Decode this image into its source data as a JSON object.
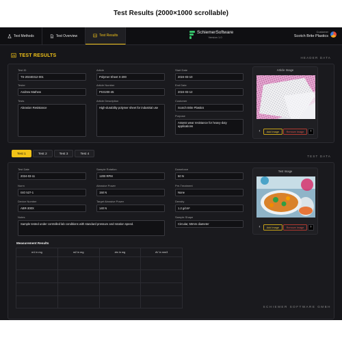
{
  "page_title": "Test Results (2000×1000 scrollable)",
  "nav": {
    "items": [
      {
        "label": "Test Methods"
      },
      {
        "label": "Test Overview"
      },
      {
        "label": "Test Results"
      }
    ]
  },
  "brand": {
    "name": "SchiemerSoftware",
    "version": "Version 1.0"
  },
  "customer": {
    "label": "Customer",
    "name": "Scotch Brite Plastics"
  },
  "header_section": {
    "title": "TEST RESULTS",
    "tag": "HEADER DATA"
  },
  "header": {
    "test_id": {
      "label": "Test ID",
      "value": "TS-20240312-001"
    },
    "tester": {
      "label": "Tester",
      "value": "Andrew Mathew"
    },
    "tests": {
      "label": "Tests",
      "value": "Abrasion Resistance"
    },
    "article": {
      "label": "Article",
      "value": "Polymer Sheet X-200"
    },
    "article_number": {
      "label": "Article Number",
      "value": "PSX200-45"
    },
    "article_description": {
      "label": "Article Description",
      "value": "High-durability polymer sheet for industrial use"
    },
    "start_date": {
      "label": "Start Date",
      "value": "2024-03-10"
    },
    "end_date": {
      "label": "End Date",
      "value": "2024-03-12"
    },
    "customer": {
      "label": "Customer",
      "value": "Scotch Brite Plastics"
    },
    "purpose": {
      "label": "Purpose",
      "value": "Assess wear resistance for heavy-duty applications"
    },
    "image_card": {
      "title": "Article Image",
      "add_label": "Add Image",
      "remove_label": "Remove Image",
      "prev": "‹",
      "next": "›"
    }
  },
  "test_tabs": [
    {
      "label": "Test 1",
      "active": true
    },
    {
      "label": "Test 2"
    },
    {
      "label": "Test 3"
    },
    {
      "label": "Test 4"
    }
  ],
  "test_section": {
    "tag": "TEST DATA"
  },
  "test": {
    "test_date": {
      "label": "Test Date",
      "value": "2024-03-11"
    },
    "norm": {
      "label": "Norm",
      "value": "ISO 527-1"
    },
    "device_number": {
      "label": "Device Number",
      "value": "ABR-300X"
    },
    "sample_rotation": {
      "label": "Sample Rotation",
      "value": "1200 RPM"
    },
    "abrasive_power": {
      "label": "Abrasive Power",
      "value": "150 N"
    },
    "target_abrasive_power": {
      "label": "Target Abrasive Power",
      "value": "140 N"
    },
    "downforce": {
      "label": "Downforce",
      "value": "50 N"
    },
    "pre_treatment": {
      "label": "Pre-Treatment",
      "value": "None"
    },
    "density": {
      "label": "Density",
      "value": "1.2 g/cm³"
    },
    "sample_shape": {
      "label": "Sample Shape",
      "value": "Circular, 50mm diameter"
    },
    "notes": {
      "label": "Notes",
      "value": "Sample tested under controlled lab conditions with standard pressure and rotation speed."
    },
    "image_card": {
      "title": "Test Image",
      "add_label": "Add Image",
      "remove_label": "Remove Image",
      "prev": "‹",
      "next": "›"
    }
  },
  "measurements": {
    "title": "Measurement Results",
    "columns": [
      "m1 in mg",
      "m2 in mg",
      "dm in mg",
      "dV in mm3"
    ]
  },
  "footer": "SCHIEMER SOFTWARE GMBH",
  "colors": {
    "accent": "#f2c318",
    "background": "#16161a",
    "danger": "#e2554a",
    "brand_green": "#37c46b"
  }
}
